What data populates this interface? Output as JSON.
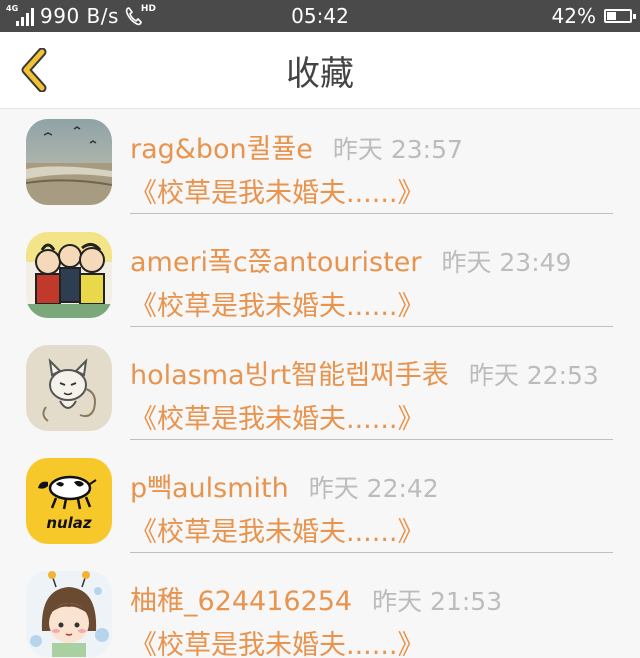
{
  "status_bar": {
    "network_type": "4G",
    "speed": "990 B/s",
    "hd_label": "HD",
    "time": "05:42",
    "battery_percent": "42%",
    "battery_level": 0.42
  },
  "header": {
    "title": "收藏",
    "back_icon": "chevron-left-icon"
  },
  "colors": {
    "accent": "#e8944e",
    "back_arrow": "#f1c232",
    "timestamp": "#bcbcbc",
    "title": "#444444",
    "status_bar_bg": "#4a4a4a"
  },
  "favorites": [
    {
      "nickname": "rag&bon퀼퓰e",
      "time": "昨天 23:57",
      "book": "《校草是我未婚夫......》",
      "avatar": "seaside-avatar"
    },
    {
      "nickname": "ameri퐄c쯙antourister",
      "time": "昨天 23:49",
      "book": "《校草是我未婚夫......》",
      "avatar": "cartoon-group-avatar"
    },
    {
      "nickname": "holasma빙rt智能렙쩌手表",
      "time": "昨天 22:53",
      "book": "《校草是我未婚夫......》",
      "avatar": "cat-doodle-avatar"
    },
    {
      "nickname": "p빽aulsmith",
      "time": "昨天 22:42",
      "book": "《校草是我未婚夫......》",
      "avatar": "nulaz-cow-avatar",
      "avatar_text": "nulaz"
    },
    {
      "nickname": "柚稚_624416254",
      "time": "昨天 21:53",
      "book": "《校草是我未婚夫......》",
      "avatar": "cartoon-girl-avatar"
    }
  ]
}
